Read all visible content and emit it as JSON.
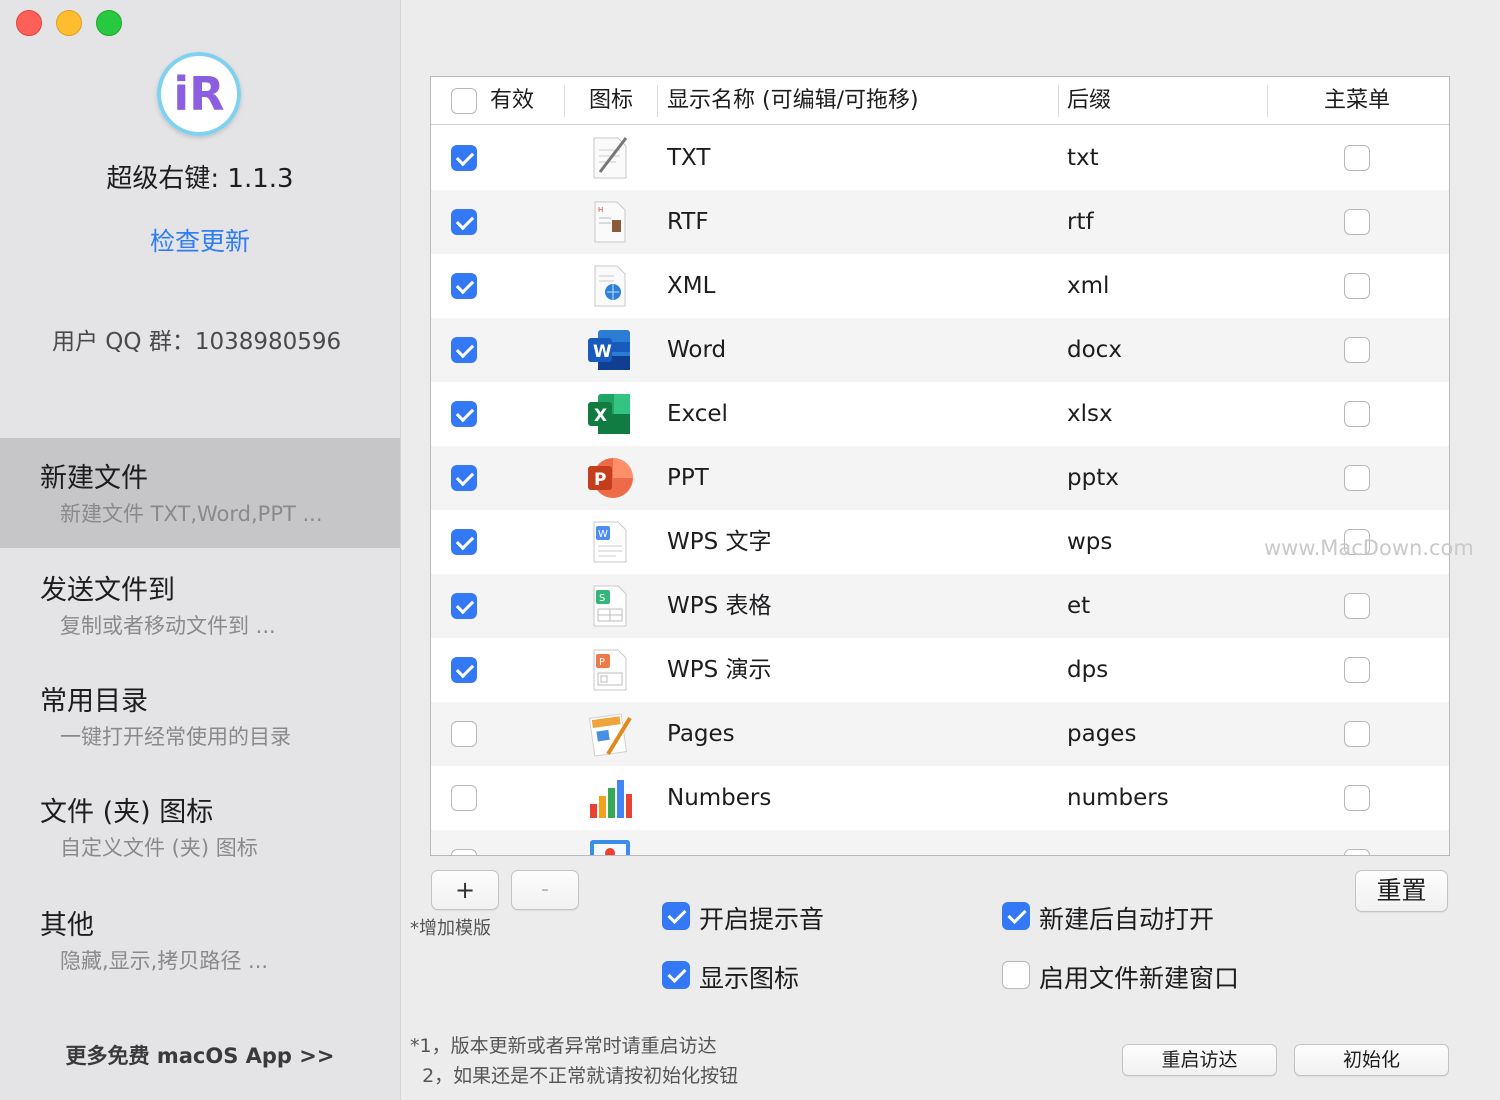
{
  "sidebar": {
    "app_version": "超级右键: 1.1.3",
    "logo_letter": "iR",
    "check_update": "检查更新",
    "qq_group": "用户 QQ 群：1038980596",
    "nav": [
      {
        "title": "新建文件",
        "subtitle": "新建文件 TXT,Word,PPT ...",
        "active": true
      },
      {
        "title": "发送文件到",
        "subtitle": "复制或者移动文件到 ..."
      },
      {
        "title": "常用目录",
        "subtitle": "一键打开经常使用的目录"
      },
      {
        "title": "文件 (夹) 图标",
        "subtitle": "自定义文件 (夹) 图标"
      },
      {
        "title": "其他",
        "subtitle": "隐藏,显示,拷贝路径 ..."
      }
    ],
    "more_apps": "更多免费 macOS App >>"
  },
  "table": {
    "headers": {
      "enabled": "有效",
      "icon": "图标",
      "name": "显示名称 (可编辑/可拖移)",
      "ext": "后缀",
      "main_menu": "主菜单"
    },
    "rows": [
      {
        "enabled": true,
        "name": "TXT",
        "ext": "txt",
        "main_menu": false,
        "icon": "txt-document-icon"
      },
      {
        "enabled": true,
        "name": "RTF",
        "ext": "rtf",
        "main_menu": false,
        "icon": "rtf-document-icon"
      },
      {
        "enabled": true,
        "name": "XML",
        "ext": "xml",
        "main_menu": false,
        "icon": "xml-document-icon"
      },
      {
        "enabled": true,
        "name": "Word",
        "ext": "docx",
        "main_menu": false,
        "icon": "word-icon"
      },
      {
        "enabled": true,
        "name": "Excel",
        "ext": "xlsx",
        "main_menu": false,
        "icon": "excel-icon"
      },
      {
        "enabled": true,
        "name": "PPT",
        "ext": "pptx",
        "main_menu": false,
        "icon": "powerpoint-icon"
      },
      {
        "enabled": true,
        "name": "WPS 文字",
        "ext": "wps",
        "main_menu": false,
        "icon": "wps-writer-icon"
      },
      {
        "enabled": true,
        "name": "WPS 表格",
        "ext": "et",
        "main_menu": false,
        "icon": "wps-spreadsheet-icon"
      },
      {
        "enabled": true,
        "name": "WPS 演示",
        "ext": "dps",
        "main_menu": false,
        "icon": "wps-presentation-icon"
      },
      {
        "enabled": false,
        "name": "Pages",
        "ext": "pages",
        "main_menu": false,
        "icon": "pages-icon"
      },
      {
        "enabled": false,
        "name": "Numbers",
        "ext": "numbers",
        "main_menu": false,
        "icon": "numbers-icon"
      },
      {
        "enabled": false,
        "name": "",
        "ext": "",
        "main_menu": false,
        "icon": "keynote-icon"
      }
    ]
  },
  "controls": {
    "add_label": "+",
    "remove_label": "-",
    "add_template_note": "*增加模版",
    "reset_label": "重置",
    "options": [
      {
        "label": "开启提示音",
        "checked": true
      },
      {
        "label": "新建后自动打开",
        "checked": true
      },
      {
        "label": "显示图标",
        "checked": true
      },
      {
        "label": "启用文件新建窗口",
        "checked": false
      }
    ],
    "notes": [
      "*1，版本更新或者异常时请重启访达",
      "  2，如果还是不正常就请按初始化按钮"
    ],
    "restart_finder_label": "重启访达",
    "initialize_label": "初始化"
  },
  "watermark": "www.MacDown.com",
  "colors": {
    "accent": "#3478f6",
    "link": "#2e7cf6",
    "sidebar_active": "#c6c5c8"
  }
}
